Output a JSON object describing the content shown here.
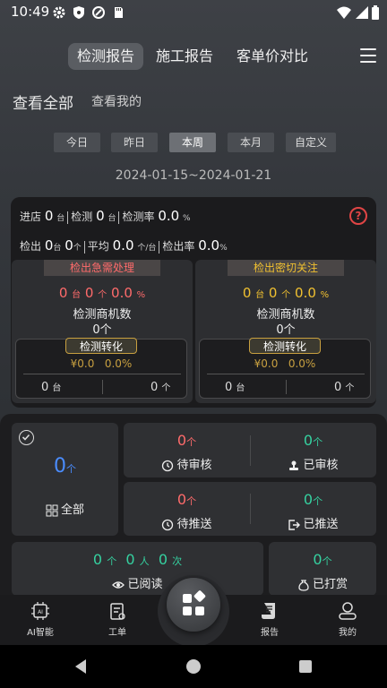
{
  "status_bar": {
    "time": "10:49"
  },
  "tabs": [
    {
      "label": "检测报告"
    },
    {
      "label": "施工报告"
    },
    {
      "label": "客单价对比"
    }
  ],
  "scope": {
    "all_label": "查看全部",
    "mine_label": "查看我的"
  },
  "periods": [
    "今日",
    "昨日",
    "本周",
    "本月",
    "自定义"
  ],
  "date_range": "2024-01-15~2024-01-21",
  "stats": {
    "enter_label": "进店",
    "enter_value": "0",
    "enter_unit": "台",
    "detect_label": "检测",
    "detect_value": "0",
    "detect_unit": "台",
    "detect_rate_label": "检测率",
    "detect_rate_value": "0.0",
    "detect_rate_unit": "%",
    "found_label": "检出",
    "found_value": "0",
    "found_unit": "台",
    "found_value2": "0",
    "found_unit2": "个",
    "avg_label": "平均",
    "avg_value": "0.0",
    "avg_unit": "个/台",
    "found_rate_label": "检出率",
    "found_rate_value": "0.0",
    "found_rate_unit": "%",
    "help": "?"
  },
  "urgent": {
    "title": "检出急需处理",
    "v1": "0",
    "u1": "台",
    "v2": "0",
    "u2": "个",
    "v3": "0.0",
    "u3": "%",
    "label": "检测商机数",
    "count": "0个",
    "conv": {
      "title": "检测转化",
      "money": "¥0.0",
      "rate": "0.0%",
      "v1": "0",
      "u1": "台",
      "v2": "0",
      "u2": "个"
    }
  },
  "close": {
    "title": "检出密切关注",
    "v1": "0",
    "u1": "台",
    "v2": "0",
    "u2": "个",
    "v3": "0.0",
    "u3": "%",
    "label": "检测商机数",
    "count": "0个",
    "conv": {
      "title": "检测转化",
      "money": "¥0.0",
      "rate": "0.0%",
      "v1": "0",
      "u1": "台",
      "v2": "0",
      "u2": "个"
    }
  },
  "tasks": {
    "all": {
      "value": "0",
      "unit": "个",
      "label": "全部"
    },
    "pending_review": {
      "value": "0",
      "unit": "个",
      "label": "待审核"
    },
    "reviewed": {
      "value": "0",
      "unit": "个",
      "label": "已审核"
    },
    "pending_push": {
      "value": "0",
      "unit": "个",
      "label": "待推送"
    },
    "pushed": {
      "value": "0",
      "unit": "个",
      "label": "已推送"
    },
    "read": {
      "v1": "0",
      "u1": "个",
      "v2": "0",
      "u2": "人",
      "v3": "0",
      "u3": "次",
      "label": "已阅读"
    },
    "tipped": {
      "value": "0",
      "unit": "个",
      "label": "已打赏"
    }
  },
  "nav": [
    {
      "label": "AI智能"
    },
    {
      "label": "工单"
    },
    {
      "label": "报告"
    },
    {
      "label": "我的"
    }
  ],
  "colors": {
    "red": "#ff6b6b",
    "yellow": "#f0c030",
    "green": "#35d1a0",
    "blue": "#4a8cff",
    "gold": "#c8a040"
  }
}
